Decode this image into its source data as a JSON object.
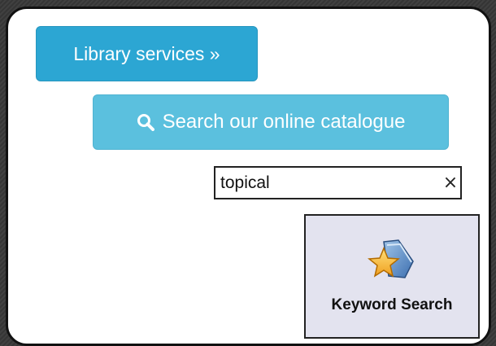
{
  "library_button": {
    "label": "Library services »"
  },
  "catalogue_button": {
    "label": "Search our online catalogue",
    "icon": "search-icon"
  },
  "search": {
    "value": "topical",
    "clear_label": "×"
  },
  "keyword_button": {
    "label": "Keyword Search",
    "icon": "star-folder-icon"
  },
  "colors": {
    "library_button": "#2ca6d3",
    "catalogue_button": "#5bc0de",
    "keyword_button_bg": "#e3e3ef"
  }
}
